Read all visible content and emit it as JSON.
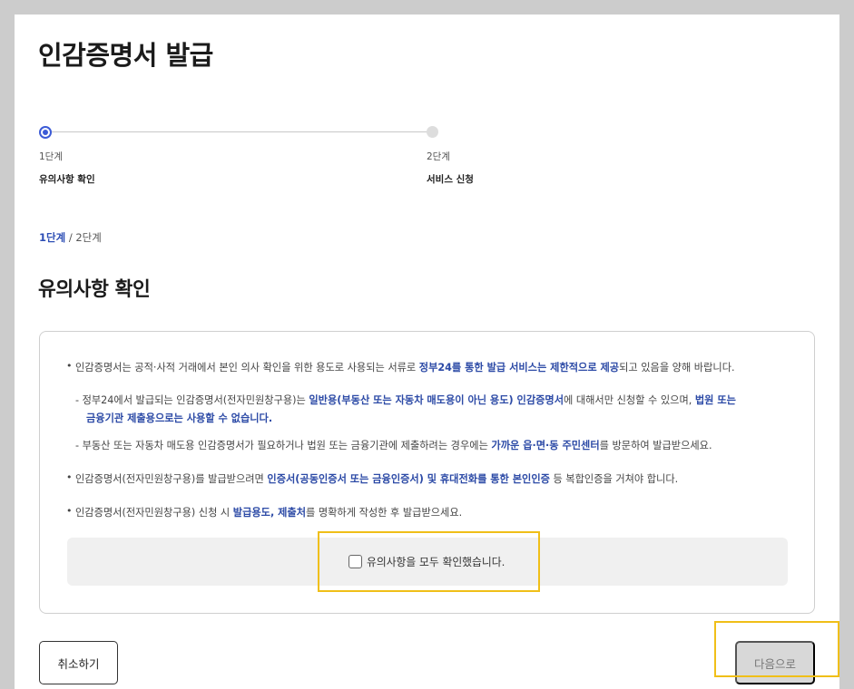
{
  "page": {
    "title": "인감증명서 발급"
  },
  "stepper": {
    "steps": [
      {
        "num": "1단계",
        "name": "유의사항 확인"
      },
      {
        "num": "2단계",
        "name": "서비스 신청"
      }
    ]
  },
  "breadcrumb": {
    "current": "1단계",
    "sep": " / ",
    "total": "2단계"
  },
  "section": {
    "title": "유의사항 확인"
  },
  "notice": {
    "bullet1": {
      "a": "인감증명서는 공적·사적 거래에서 본인 의사 확인을 위한 용도로 사용되는 서류로 ",
      "b": "정부24를 통한 발급 서비스는 제한적으로 제공",
      "c": "되고 있음을 양해 바랍니다."
    },
    "sub1": {
      "a": "- 정부24에서 발급되는 인감증명서(전자민원창구용)는 ",
      "b": "일반용(부동산 또는 자동차 매도용이 아닌 용도) 인감증명서",
      "c": "에 대해서만 신청할 수 있으며, ",
      "d": "법원 또는",
      "e": "금융기관 제출용으로는 사용할 수 없습니다."
    },
    "sub2": {
      "a": "- 부동산 또는 자동차 매도용 인감증명서가 필요하거나 법원 또는 금융기관에 제출하려는 경우에는 ",
      "b": "가까운 읍·면·동 주민센터",
      "c": "를 방문하여 발급받으세요."
    },
    "bullet2": {
      "a": "인감증명서(전자민원창구용)를 발급받으려면 ",
      "b": "인증서(공동인증서 또는 금융인증서) 및 휴대전화를 통한 본인인증",
      "c": " 등 복합인증을 거쳐야 합니다."
    },
    "bullet3": {
      "a": "인감증명서(전자민원창구용) 신청 시 ",
      "b": "발급용도, 제출처",
      "c": "를 명확하게 작성한 후 발급받으세요."
    }
  },
  "confirm": {
    "label": "유의사항을 모두 확인했습니다.",
    "checked": false
  },
  "buttons": {
    "cancel": "취소하기",
    "next": "다음으로"
  },
  "colors": {
    "accent": "#2c4aa6",
    "highlight": "#f0bf18",
    "background": "#cccccc"
  }
}
